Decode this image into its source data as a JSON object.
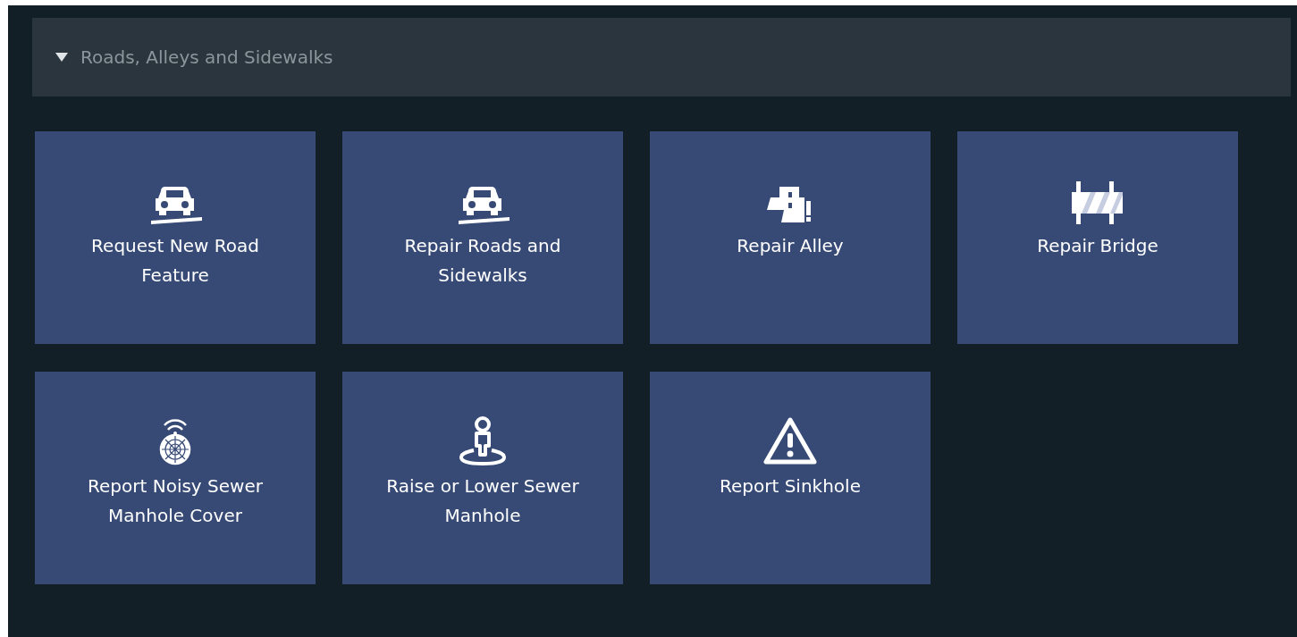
{
  "section": {
    "title": "Roads, Alleys and Sidewalks",
    "expanded": true
  },
  "tiles": [
    {
      "label": "Request New Road Feature",
      "kind": "car"
    },
    {
      "label": "Repair Roads and Sidewalks",
      "kind": "car"
    },
    {
      "label": "Repair Alley",
      "kind": "alley"
    },
    {
      "label": "Repair Bridge",
      "kind": "barrier"
    },
    {
      "label": "Report Noisy Sewer Manhole Cover",
      "kind": "manhole"
    },
    {
      "label": "Raise or Lower Sewer Manhole",
      "kind": "person"
    },
    {
      "label": "Report Sinkhole",
      "kind": "warning"
    }
  ]
}
